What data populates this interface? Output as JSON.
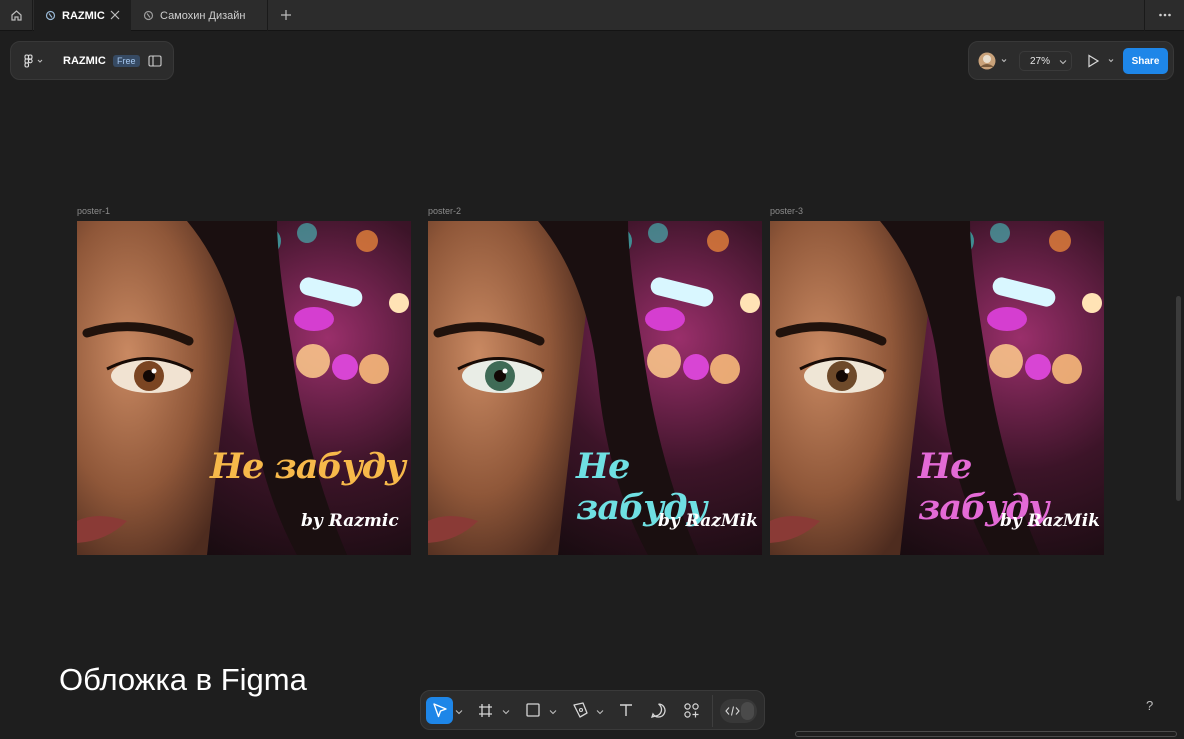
{
  "tabs": [
    {
      "label": "RAZMIC",
      "active": true
    },
    {
      "label": "Самохин Дизайн",
      "active": false
    }
  ],
  "file": {
    "name": "RAZMIC",
    "plan_badge": "Free"
  },
  "toolbar_right": {
    "zoom": "27%",
    "share_label": "Share"
  },
  "frames": [
    {
      "name": "poster-1",
      "title": "Не забуду",
      "byline": "by Razmic",
      "title_color": "#f7b94a"
    },
    {
      "name": "poster-2",
      "title": "Не забуду",
      "byline": "by RazMik",
      "title_color": "#6fe0e3"
    },
    {
      "name": "poster-3",
      "title": "Не забуду",
      "byline": "by RazMik",
      "title_color": "#e46ad6"
    }
  ],
  "caption": "Обложка в Figma",
  "help_label": "?",
  "icons": {
    "home": "home-icon",
    "tab_file": "figma-file-icon",
    "close": "close-icon",
    "add": "plus-icon",
    "more": "more-icon",
    "menu": "figma-menu-icon",
    "sidebar": "sidebar-toggle-icon",
    "play": "play-icon",
    "move": "move-tool-icon",
    "frame": "frame-tool-icon",
    "shape": "rectangle-tool-icon",
    "pen": "pen-tool-icon",
    "text": "text-tool-icon",
    "comment": "comment-tool-icon",
    "actions": "actions-icon",
    "devmode": "dev-mode-icon"
  }
}
